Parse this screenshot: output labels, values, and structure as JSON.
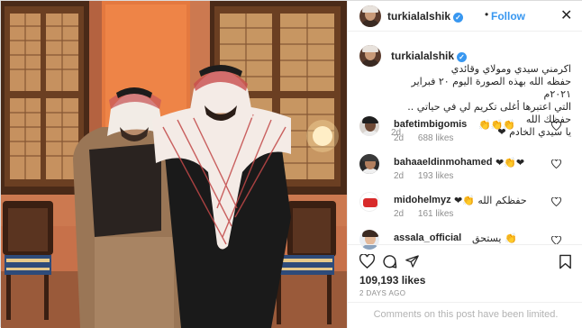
{
  "post": {
    "username": "turkialalshik",
    "verified_icon": "verified-badge-icon",
    "dot": "•",
    "follow_label": "Follow",
    "close_icon": "close-icon",
    "caption_lines": [
      "اكرمني سيدي ومولاي وقائدي",
      "حفظه الله بهذه الصورة اليوم ٢٠ فبراير ٢٠٢١م",
      "التي اعتبرها أغلى تكريم لي في حياتي .. حفظك الله",
      "يا سيدي الخادم ❤"
    ],
    "caption_age": "2d"
  },
  "comments": [
    {
      "username": "bafetimbigomis",
      "text": "👏👏👏",
      "age": "2d",
      "likes": "688 likes"
    },
    {
      "username": "bahaaeldinmohamed",
      "text": "❤👏❤",
      "age": "2d",
      "likes": "193 likes"
    },
    {
      "username": "midohelmyz",
      "text": "حفظكم الله 👏❤",
      "age": "2d",
      "likes": "161 likes"
    },
    {
      "username": "assala_official",
      "text": "👏 يستحق",
      "age": "",
      "likes": ""
    }
  ],
  "actions": {
    "like_icon": "heart-icon",
    "comment_icon": "comment-icon",
    "share_icon": "paper-plane-icon",
    "save_icon": "bookmark-icon",
    "likes_count": "109,193 likes",
    "posted_ago": "2 DAYS AGO"
  },
  "footer": {
    "comments_limited": "Comments on this post have been limited."
  },
  "colors": {
    "link_blue": "#3897f0",
    "muted_gray": "#8e8e8e",
    "border": "#efefef"
  }
}
